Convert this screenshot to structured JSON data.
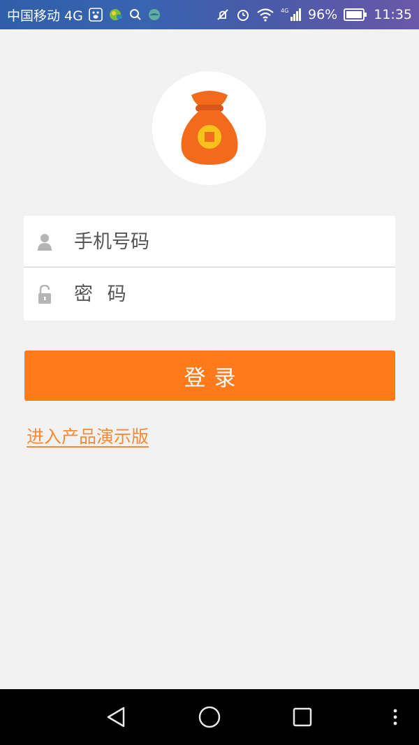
{
  "status_bar": {
    "carrier": "中国移动 4G",
    "battery": "96%",
    "time": "11:35",
    "network_label": "4G"
  },
  "login_form": {
    "phone_placeholder": "手机号码",
    "password_placeholder": "密 码"
  },
  "login_button_label": "登录",
  "demo_link_label": "进入产品演示版",
  "colors": {
    "accent": "#ff7a1a",
    "link": "#f28a3a",
    "background": "#f2f2f2"
  },
  "icons": {
    "logo": "money-bag-icon",
    "phone": "user-icon",
    "password": "lock-icon"
  }
}
